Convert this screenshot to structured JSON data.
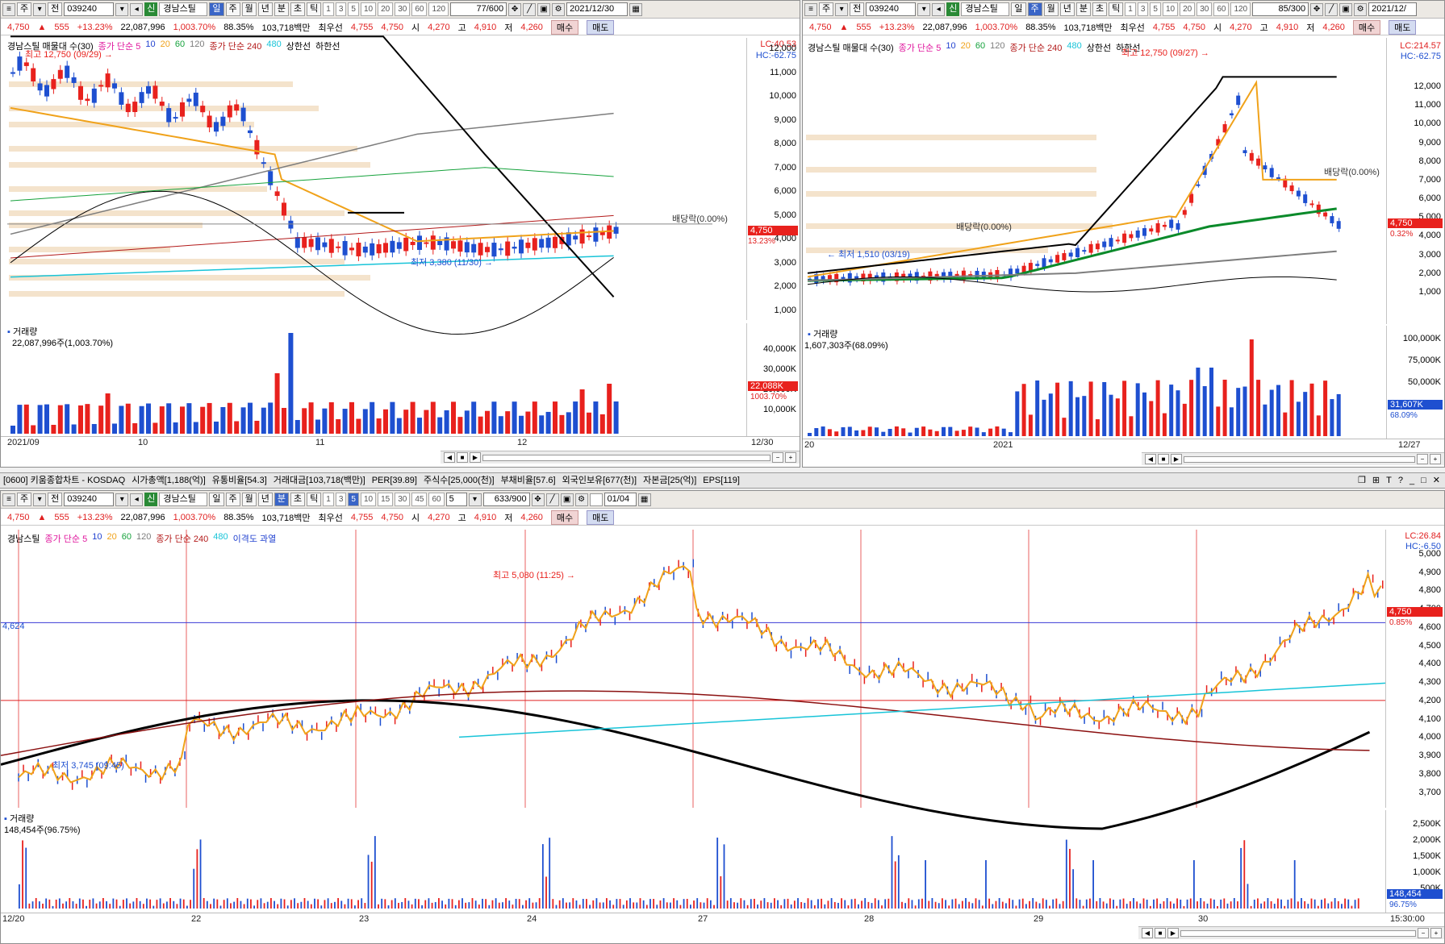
{
  "stock": {
    "code": "039240",
    "name": "경남스틸",
    "tag": "신"
  },
  "quote": {
    "price": "4,750",
    "arrow": "▲",
    "change": "555",
    "change_pct": "+13.23%",
    "volume": "22,087,996",
    "vol_ratio": "1,003.70%",
    "turnover": "88.35%",
    "amount": "103,718백만",
    "best_bid_label": "최우선",
    "bid": "4,755",
    "ask": "4,750",
    "open_label": "시",
    "open": "4,270",
    "high_label": "고",
    "high": "4,910",
    "low_label": "저",
    "low": "4,260",
    "buy": "매수",
    "sell": "매도"
  },
  "toolbar": {
    "jun": "전",
    "ju": "주",
    "day": "일",
    "week": "주",
    "month": "월",
    "year": "년",
    "minute": "분",
    "second": "초",
    "tick": "틱",
    "nums": [
      "1",
      "3",
      "5",
      "10",
      "20",
      "30",
      "60",
      "120"
    ],
    "bottom_nums": [
      "1",
      "3",
      "5",
      "10",
      "15",
      "30",
      "45",
      "60"
    ]
  },
  "left": {
    "count": "77/600",
    "date": "2021/12/30",
    "legend": [
      "경남스틸 매물대 수(30)",
      "종가 단순 5",
      "10",
      "20",
      "60",
      "120",
      "종가 단순 240",
      "480",
      "상한선",
      "하한선"
    ],
    "lc": "LC:40.53",
    "hc": "HC:-62.75",
    "high_note": "최고 12,750 (09/29) →",
    "low_note": "최저 3,380 (11/30) →",
    "dividend": "배당락(0.00%)",
    "price_tag": "4,750",
    "pct_tag": "13.23%",
    "vol_title": "거래량",
    "vol_value": "22,087,996주(1,003.70%)",
    "vol_tag": "22,088K",
    "vol_pct": "1003.70%",
    "axis": [
      "12,000",
      "11,000",
      "10,000",
      "9,000",
      "8,000",
      "7,000",
      "6,000",
      "5,000",
      "4,000",
      "3,000",
      "2,000",
      "1,000"
    ],
    "vol_axis": [
      "40,000K",
      "30,000K",
      "20,000K",
      "10,000K"
    ],
    "xlabels": [
      "2021/09",
      "10",
      "11",
      "12",
      "12/30"
    ]
  },
  "right": {
    "count": "85/300",
    "date": "2021/12/",
    "legend": [
      "경남스틸 매물대 수(30)",
      "종가 단순 5",
      "10",
      "20",
      "60",
      "120",
      "종가 단순 240",
      "480",
      "상한선",
      "하한선"
    ],
    "lc": "LC:214.57",
    "hc": "HC:-62.75",
    "high_note": "최고 12,750 (09/27) →",
    "low_note": "← 최저 1,510 (03/19)",
    "dividend": "배당락(0.00%)",
    "dividend2": "배당락(0.00%)",
    "price_tag": "4,750",
    "pct_tag": "0.32%",
    "vol_title": "거래량",
    "vol_value": "1,607,303주(68.09%)",
    "vol_tag": "31,607K",
    "vol_pct": "68.09%",
    "axis": [
      "12,000",
      "11,000",
      "10,000",
      "9,000",
      "8,000",
      "7,000",
      "6,000",
      "5,000",
      "4,000",
      "3,000",
      "2,000",
      "1,000"
    ],
    "vol_axis": [
      "100,000K",
      "75,000K",
      "50,000K",
      "25,000K"
    ],
    "xlabels": [
      "20",
      "2021",
      "12/27"
    ]
  },
  "infobar": {
    "id": "[0600] 키움종합차트 - KOSDAQ",
    "items": [
      "시가총액[1,188(억)]",
      "유통비율[54.3]",
      "거래대금[103,718(백만)]",
      "PER[39.89]",
      "주식수[25,000(천)]",
      "부채비율[57.6]",
      "외국인보유[677(천)]",
      "자본금[25(억)]",
      "EPS[119]"
    ]
  },
  "bottom": {
    "interval": "5",
    "count": "633/900",
    "date": "01/04",
    "legend": [
      "경남스틸",
      "종가 단순 5",
      "10",
      "20",
      "60",
      "120",
      "종가 단순 240",
      "480",
      "이격도 과열"
    ],
    "lc": "LC:26.84",
    "hc": "HC:-6.50",
    "high_note": "최고 5,080 (11:25) →",
    "low_note": "최저 3,745 (09:45)",
    "line_label": "4,624",
    "price_tag": "4,750",
    "pct_tag": "0.85%",
    "vol_title": "거래량",
    "vol_value": "148,454주(96.75%)",
    "vol_tag": "148,454",
    "vol_pct": "96.75%",
    "axis": [
      "5,000",
      "4,900",
      "4,800",
      "4,700",
      "4,600",
      "4,500",
      "4,400",
      "4,300",
      "4,200",
      "4,100",
      "4,000",
      "3,900",
      "3,800",
      "3,700"
    ],
    "vol_axis": [
      "2,500K",
      "2,000K",
      "1,500K",
      "1,000K",
      "500K"
    ],
    "xlabels": [
      "12/20",
      "22",
      "23",
      "24",
      "27",
      "28",
      "29",
      "30",
      "15:30:00"
    ]
  },
  "colors": {
    "up": "#e8211d",
    "down": "#1e4fd0",
    "ma5": "#e0189e",
    "ma10": "#2343d0",
    "ma20": "#f0a21a",
    "ma60": "#16a23c",
    "ma120": "#7d7d7d",
    "ma240": "#000000",
    "ma480": "#18c4d8",
    "band": "#000000"
  }
}
